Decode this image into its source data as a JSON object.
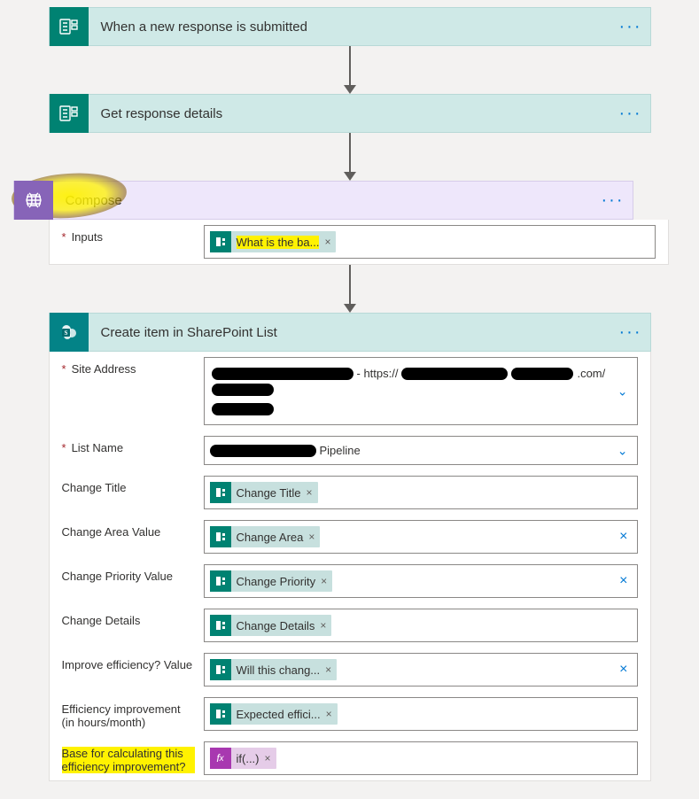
{
  "step1": {
    "title": "When a new response is submitted"
  },
  "step2": {
    "title": "Get response details"
  },
  "compose": {
    "title": "Compose",
    "inputs_label": "Inputs",
    "token": "What is the ba..."
  },
  "sp": {
    "title": "Create item in SharePoint List",
    "fields": {
      "site_address": {
        "label": "Site Address",
        "visible_text": "- https://",
        "domain_frag": ".com/"
      },
      "list_name": {
        "label": "List Name",
        "visible_text": "Pipeline"
      },
      "change_title": {
        "label": "Change Title",
        "token": "Change Title"
      },
      "change_area": {
        "label": "Change Area Value",
        "token": "Change Area"
      },
      "change_priority": {
        "label": "Change Priority Value",
        "token": "Change Priority"
      },
      "change_details": {
        "label": "Change Details",
        "token": "Change Details"
      },
      "improve_eff": {
        "label": "Improve efficiency? Value",
        "token": "Will this chang..."
      },
      "eff_hours": {
        "label": "Efficiency improvement (in hours/month)",
        "token": "Expected effici..."
      },
      "base_calc": {
        "label": "Base for calculating this efficiency improvement?",
        "token": "if(...)"
      }
    }
  }
}
